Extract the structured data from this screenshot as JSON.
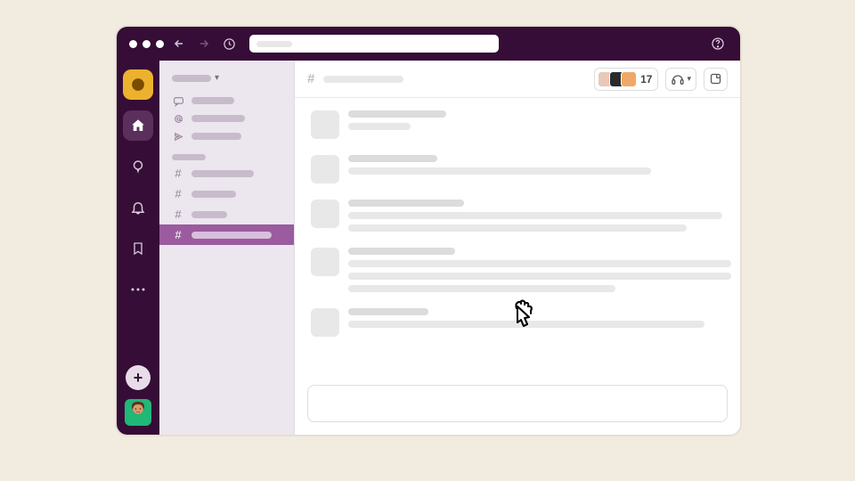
{
  "header": {
    "member_count": "17"
  },
  "channels": [
    {
      "width": 70,
      "active": false
    },
    {
      "width": 50,
      "active": false
    },
    {
      "width": 40,
      "active": false
    },
    {
      "width": 90,
      "active": true
    }
  ],
  "nav_items": [
    {
      "icon": "threads",
      "width": 48
    },
    {
      "icon": "mentions",
      "width": 60
    },
    {
      "icon": "drafts",
      "width": 56
    }
  ],
  "messages": [
    {
      "lines": [
        110,
        70
      ]
    },
    {
      "lines": [
        100,
        340
      ]
    },
    {
      "lines": [
        130,
        420,
        380
      ]
    },
    {
      "lines": [
        120,
        430,
        430,
        300
      ]
    },
    {
      "lines": [
        90,
        400
      ]
    }
  ],
  "member_colors": [
    "#e8c9b8",
    "#2b2b2b",
    "#f0a868"
  ]
}
